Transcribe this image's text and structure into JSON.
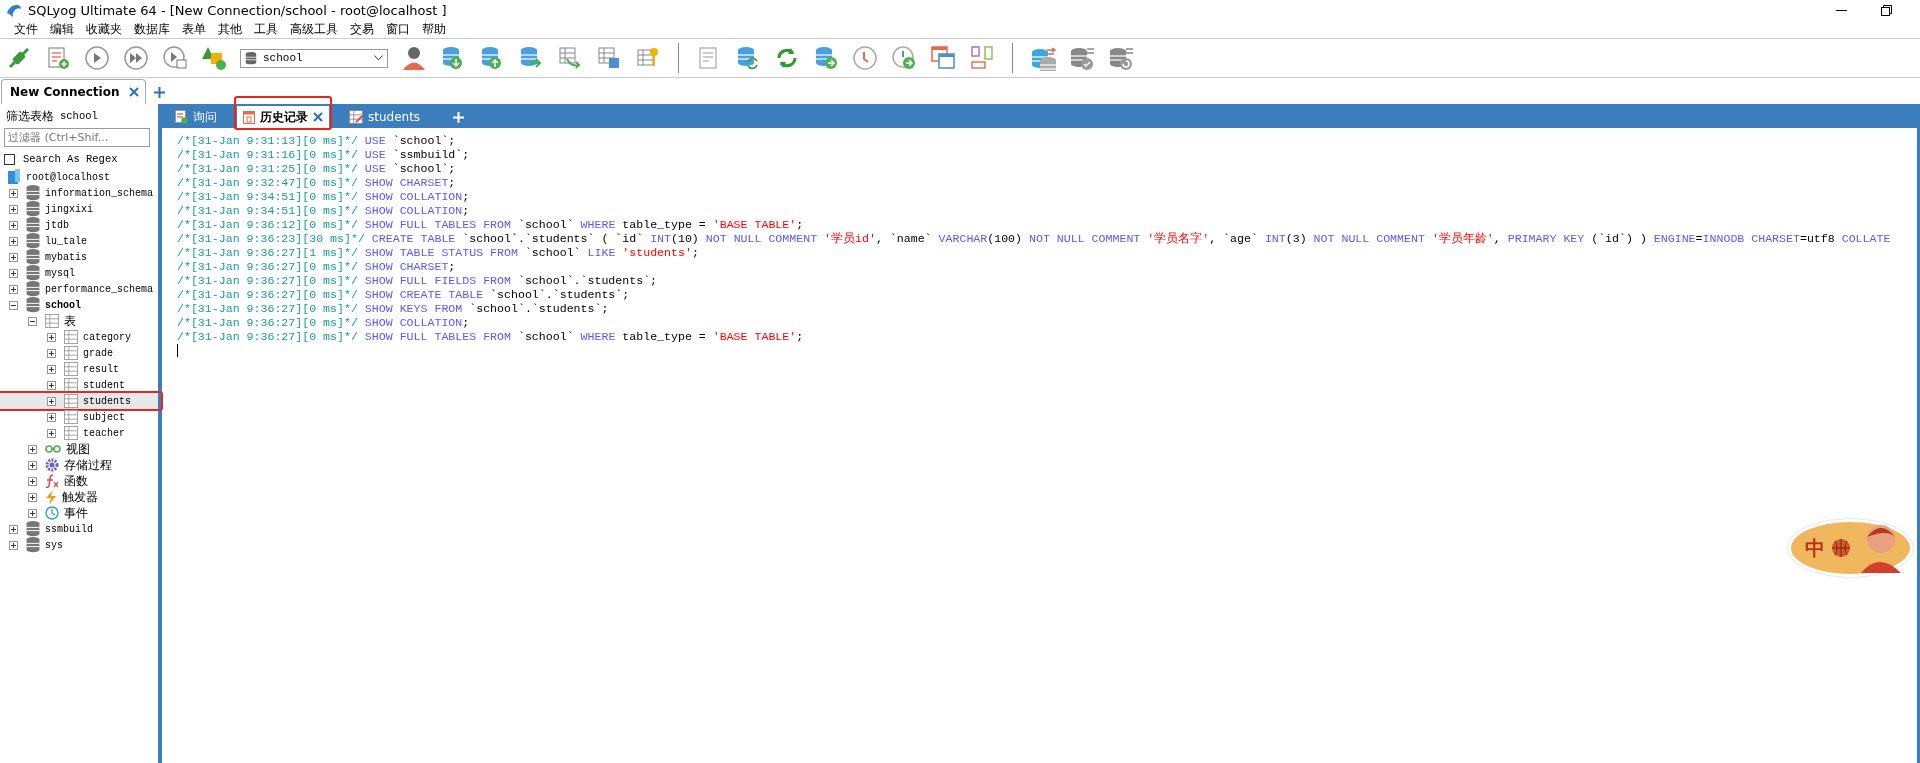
{
  "window": {
    "title": "SQLyog Ultimate 64 - [New Connection/school - root@localhost ]"
  },
  "menu": [
    "文件",
    "编辑",
    "收藏夹",
    "数据库",
    "表单",
    "其他",
    "工具",
    "高级工具",
    "交易",
    "窗口",
    "帮助"
  ],
  "toolbar": {
    "database_select": "school"
  },
  "connection_tabs": [
    {
      "label": "New Connection",
      "selected": true,
      "closable": true
    }
  ],
  "sidebar": {
    "header_label": "筛选表格",
    "header_db": "school",
    "filter": {
      "placeholder": "过滤器 (Ctrl+Shif..."
    },
    "regex": {
      "label": "Search As Regex",
      "checked": false
    },
    "tree": [
      {
        "label": "root@localhost",
        "kind": "server",
        "selected": false,
        "marked": false,
        "children": [
          {
            "label": "information_schema",
            "kind": "db",
            "expanded": false,
            "selected": false,
            "marked": false
          },
          {
            "label": "jingxixi",
            "kind": "db",
            "expanded": false,
            "selected": false,
            "marked": false
          },
          {
            "label": "jtdb",
            "kind": "db",
            "expanded": false,
            "selected": false,
            "marked": false
          },
          {
            "label": "lu_tale",
            "kind": "db",
            "expanded": false,
            "selected": false,
            "marked": false
          },
          {
            "label": "mybatis",
            "kind": "db",
            "expanded": false,
            "selected": false,
            "marked": false
          },
          {
            "label": "mysql",
            "kind": "db",
            "expanded": false,
            "selected": false,
            "marked": false
          },
          {
            "label": "performance_schema",
            "kind": "db",
            "expanded": false,
            "selected": false,
            "marked": false
          },
          {
            "label": "school",
            "kind": "db",
            "expanded": true,
            "selected": false,
            "marked": false,
            "bold": true,
            "children": [
              {
                "label": "表",
                "kind": "tables",
                "expanded": true,
                "selected": false,
                "marked": false,
                "children": [
                  {
                    "label": "category",
                    "kind": "table",
                    "expanded": false,
                    "selected": false,
                    "marked": false
                  },
                  {
                    "label": "grade",
                    "kind": "table",
                    "expanded": false,
                    "selected": false,
                    "marked": false
                  },
                  {
                    "label": "result",
                    "kind": "table",
                    "expanded": false,
                    "selected": false,
                    "marked": false
                  },
                  {
                    "label": "student",
                    "kind": "table",
                    "expanded": false,
                    "selected": false,
                    "marked": false
                  },
                  {
                    "label": "students",
                    "kind": "table",
                    "expanded": false,
                    "selected": true,
                    "marked": true
                  },
                  {
                    "label": "subject",
                    "kind": "table",
                    "expanded": false,
                    "selected": false,
                    "marked": false
                  },
                  {
                    "label": "teacher",
                    "kind": "table",
                    "expanded": false,
                    "selected": false,
                    "marked": false
                  }
                ]
              },
              {
                "label": "视图",
                "kind": "view",
                "expanded": false,
                "selected": false,
                "marked": false
              },
              {
                "label": "存储过程",
                "kind": "proc",
                "expanded": false,
                "selected": false,
                "marked": false
              },
              {
                "label": "函数",
                "kind": "func",
                "expanded": false,
                "selected": false,
                "marked": false
              },
              {
                "label": "触发器",
                "kind": "trigger",
                "expanded": false,
                "selected": false,
                "marked": false
              },
              {
                "label": "事件",
                "kind": "event",
                "expanded": false,
                "selected": false,
                "marked": false
              }
            ]
          },
          {
            "label": "ssmbuild",
            "kind": "db",
            "expanded": false,
            "selected": false,
            "marked": false
          },
          {
            "label": "sys",
            "kind": "db",
            "expanded": false,
            "selected": false,
            "marked": false
          }
        ]
      }
    ]
  },
  "editor_tabs": [
    {
      "label": "询问",
      "kind": "query",
      "selected": false,
      "closable": false,
      "marked": false
    },
    {
      "label": "历史记录",
      "kind": "history",
      "selected": true,
      "closable": true,
      "marked": true
    },
    {
      "label": "students",
      "kind": "table",
      "selected": false,
      "closable": false,
      "marked": false
    }
  ],
  "history": [
    {
      "stamp": "/*[31-Jan 9:31:13][0 ms]*/",
      "tokens": [
        {
          "kind": "kw",
          "text": " USE"
        },
        {
          "kind": "id",
          "text": " `school`;"
        }
      ]
    },
    {
      "stamp": "/*[31-Jan 9:31:16][0 ms]*/",
      "tokens": [
        {
          "kind": "kw",
          "text": " USE"
        },
        {
          "kind": "id",
          "text": " `ssmbuild`;"
        }
      ]
    },
    {
      "stamp": "/*[31-Jan 9:31:25][0 ms]*/",
      "tokens": [
        {
          "kind": "kw",
          "text": " USE"
        },
        {
          "kind": "id",
          "text": " `school`;"
        }
      ]
    },
    {
      "stamp": "/*[31-Jan 9:32:47][0 ms]*/",
      "tokens": [
        {
          "kind": "kw",
          "text": " SHOW CHARSET"
        },
        {
          "kind": "id",
          "text": ";"
        }
      ]
    },
    {
      "stamp": "/*[31-Jan 9:34:51][0 ms]*/",
      "tokens": [
        {
          "kind": "kw",
          "text": " SHOW COLLATION"
        },
        {
          "kind": "id",
          "text": ";"
        }
      ]
    },
    {
      "stamp": "/*[31-Jan 9:34:51][0 ms]*/",
      "tokens": [
        {
          "kind": "kw",
          "text": " SHOW COLLATION"
        },
        {
          "kind": "id",
          "text": ";"
        }
      ]
    },
    {
      "stamp": "/*[31-Jan 9:36:12][0 ms]*/",
      "tokens": [
        {
          "kind": "kw",
          "text": " SHOW FULL TABLES FROM"
        },
        {
          "kind": "id",
          "text": " `school` "
        },
        {
          "kind": "kw",
          "text": "WHERE"
        },
        {
          "kind": "id",
          "text": " table_type = "
        },
        {
          "kind": "str",
          "text": "'BASE TABLE'"
        },
        {
          "kind": "id",
          "text": ";"
        }
      ]
    },
    {
      "stamp": "/*[31-Jan 9:36:23][30 ms]*/",
      "tokens": [
        {
          "kind": "kw",
          "text": " CREATE TABLE"
        },
        {
          "kind": "id",
          "text": " `school`.`students` ( `id` "
        },
        {
          "kind": "kw",
          "text": "INT"
        },
        {
          "kind": "id",
          "text": "(10) "
        },
        {
          "kind": "kw",
          "text": "NOT NULL COMMENT "
        },
        {
          "kind": "str",
          "text": "'学员id'"
        },
        {
          "kind": "id",
          "text": ", `name` "
        },
        {
          "kind": "kw",
          "text": "VARCHAR"
        },
        {
          "kind": "id",
          "text": "(100) "
        },
        {
          "kind": "kw",
          "text": "NOT NULL COMMENT "
        },
        {
          "kind": "str",
          "text": "'学员名字'"
        },
        {
          "kind": "id",
          "text": ", `age` "
        },
        {
          "kind": "kw",
          "text": "INT"
        },
        {
          "kind": "id",
          "text": "(3) "
        },
        {
          "kind": "kw",
          "text": "NOT NULL COMMENT "
        },
        {
          "kind": "str",
          "text": "'学员年龄'"
        },
        {
          "kind": "id",
          "text": ", "
        },
        {
          "kind": "kw",
          "text": "PRIMARY KEY"
        },
        {
          "kind": "id",
          "text": " (`id`) ) "
        },
        {
          "kind": "kw",
          "text": "ENGINE"
        },
        {
          "kind": "id",
          "text": "="
        },
        {
          "kind": "kw",
          "text": "INNODB CHARSET"
        },
        {
          "kind": "id",
          "text": "=utf8 "
        },
        {
          "kind": "kw",
          "text": "COLLATE"
        }
      ]
    },
    {
      "stamp": "/*[31-Jan 9:36:27][1 ms]*/",
      "tokens": [
        {
          "kind": "kw",
          "text": " SHOW TABLE STATUS FROM"
        },
        {
          "kind": "id",
          "text": " `school` "
        },
        {
          "kind": "kw",
          "text": "LIKE "
        },
        {
          "kind": "str",
          "text": "'students'"
        },
        {
          "kind": "id",
          "text": ";"
        }
      ]
    },
    {
      "stamp": "/*[31-Jan 9:36:27][0 ms]*/",
      "tokens": [
        {
          "kind": "kw",
          "text": " SHOW CHARSET"
        },
        {
          "kind": "id",
          "text": ";"
        }
      ]
    },
    {
      "stamp": "/*[31-Jan 9:36:27][0 ms]*/",
      "tokens": [
        {
          "kind": "kw",
          "text": " SHOW FULL FIELDS FROM"
        },
        {
          "kind": "id",
          "text": " `school`.`students`;"
        }
      ]
    },
    {
      "stamp": "/*[31-Jan 9:36:27][0 ms]*/",
      "tokens": [
        {
          "kind": "kw",
          "text": " SHOW CREATE TABLE"
        },
        {
          "kind": "id",
          "text": " `school`.`students`;"
        }
      ]
    },
    {
      "stamp": "/*[31-Jan 9:36:27][0 ms]*/",
      "tokens": [
        {
          "kind": "kw",
          "text": " SHOW KEYS FROM"
        },
        {
          "kind": "id",
          "text": " `school`.`students`;"
        }
      ]
    },
    {
      "stamp": "/*[31-Jan 9:36:27][0 ms]*/",
      "tokens": [
        {
          "kind": "kw",
          "text": " SHOW COLLATION"
        },
        {
          "kind": "id",
          "text": ";"
        }
      ]
    },
    {
      "stamp": "/*[31-Jan 9:36:27][0 ms]*/",
      "tokens": [
        {
          "kind": "kw",
          "text": " SHOW FULL TABLES FROM"
        },
        {
          "kind": "id",
          "text": " `school` "
        },
        {
          "kind": "kw",
          "text": "WHERE"
        },
        {
          "kind": "id",
          "text": " table_type = "
        },
        {
          "kind": "str",
          "text": "'BASE TABLE'"
        },
        {
          "kind": "id",
          "text": ";"
        }
      ]
    }
  ],
  "ime": {
    "label": "中"
  }
}
